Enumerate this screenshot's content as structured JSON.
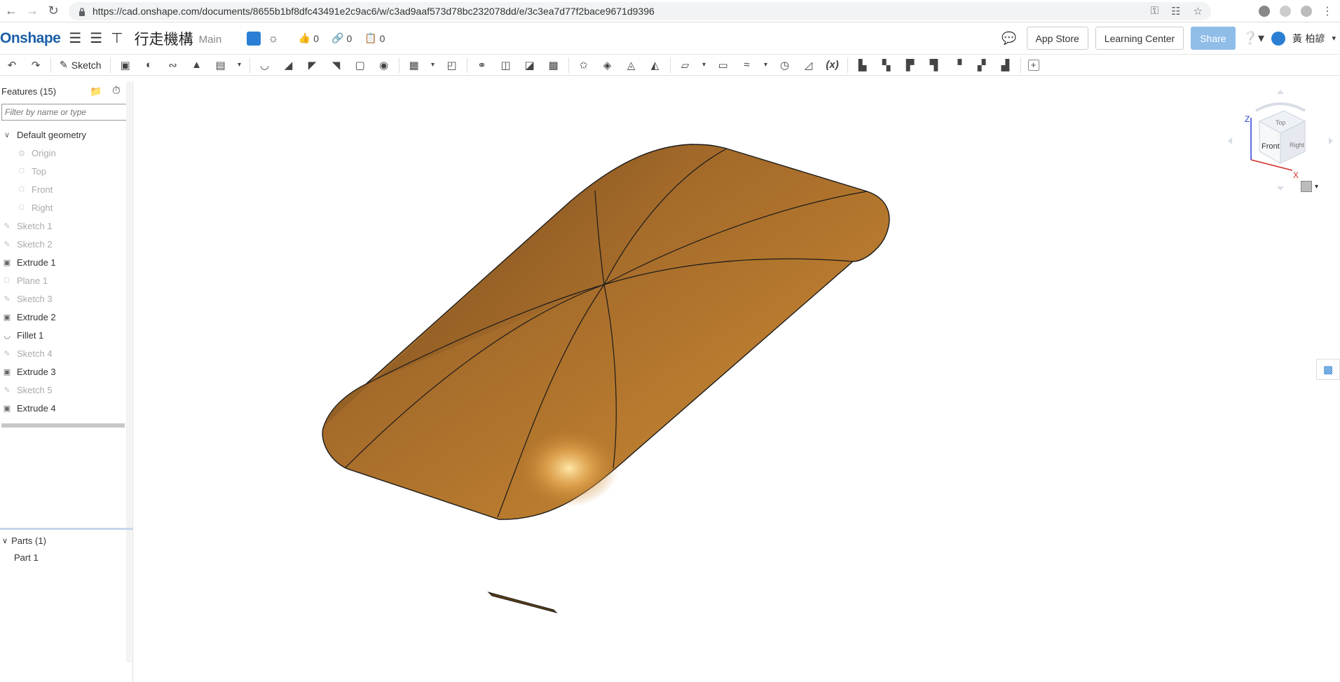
{
  "browser": {
    "url": "https://cad.onshape.com/documents/8655b1bf8dfc43491e2c9ac6/w/c3ad9aaf573d78bc232078dd/e/3c3ea7d77f2bace9671d9396"
  },
  "header": {
    "logo": "Onshape",
    "doc_title": "行走機構",
    "branch": "Main",
    "likes": "0",
    "links": "0",
    "copies": "0",
    "app_store": "App Store",
    "learning_center": "Learning Center",
    "share": "Share",
    "user_name": "黃 柏諺"
  },
  "toolbar": {
    "sketch_label": "Sketch"
  },
  "features": {
    "title": "Features (15)",
    "filter_placeholder": "Filter by name or type",
    "items": [
      {
        "label": "Default geometry",
        "type": "group",
        "dim": false,
        "icon": "chevron-down-icon"
      },
      {
        "label": "Origin",
        "type": "origin",
        "dim": true,
        "indent": true,
        "icon": "origin-icon"
      },
      {
        "label": "Top",
        "type": "plane",
        "dim": true,
        "indent": true,
        "icon": "plane-icon"
      },
      {
        "label": "Front",
        "type": "plane",
        "dim": true,
        "indent": true,
        "icon": "plane-icon"
      },
      {
        "label": "Right",
        "type": "plane",
        "dim": true,
        "indent": true,
        "icon": "plane-icon"
      },
      {
        "label": "Sketch 1",
        "type": "sketch",
        "dim": true,
        "icon": "sketch-icon"
      },
      {
        "label": "Sketch 2",
        "type": "sketch",
        "dim": true,
        "icon": "sketch-icon"
      },
      {
        "label": "Extrude 1",
        "type": "extrude",
        "dim": false,
        "icon": "extrude-icon"
      },
      {
        "label": "Plane 1",
        "type": "plane",
        "dim": true,
        "icon": "plane-icon"
      },
      {
        "label": "Sketch 3",
        "type": "sketch",
        "dim": true,
        "icon": "sketch-icon"
      },
      {
        "label": "Extrude 2",
        "type": "extrude",
        "dim": false,
        "icon": "extrude-icon"
      },
      {
        "label": "Fillet 1",
        "type": "fillet",
        "dim": false,
        "icon": "fillet-icon"
      },
      {
        "label": "Sketch 4",
        "type": "sketch",
        "dim": true,
        "icon": "sketch-icon"
      },
      {
        "label": "Extrude 3",
        "type": "extrude",
        "dim": false,
        "icon": "extrude-icon"
      },
      {
        "label": "Sketch 5",
        "type": "sketch",
        "dim": true,
        "icon": "sketch-icon"
      },
      {
        "label": "Extrude 4",
        "type": "extrude",
        "dim": false,
        "icon": "extrude-icon"
      }
    ]
  },
  "parts": {
    "title": "Parts (1)",
    "items": [
      "Part 1"
    ]
  },
  "view_cube": {
    "top": "Top",
    "front": "Front",
    "right": "Right",
    "axis_z": "Z",
    "axis_x": "X"
  },
  "colors": {
    "brand": "#1a5fa8",
    "model": "#b87a2e",
    "share": "#8fbde8"
  }
}
